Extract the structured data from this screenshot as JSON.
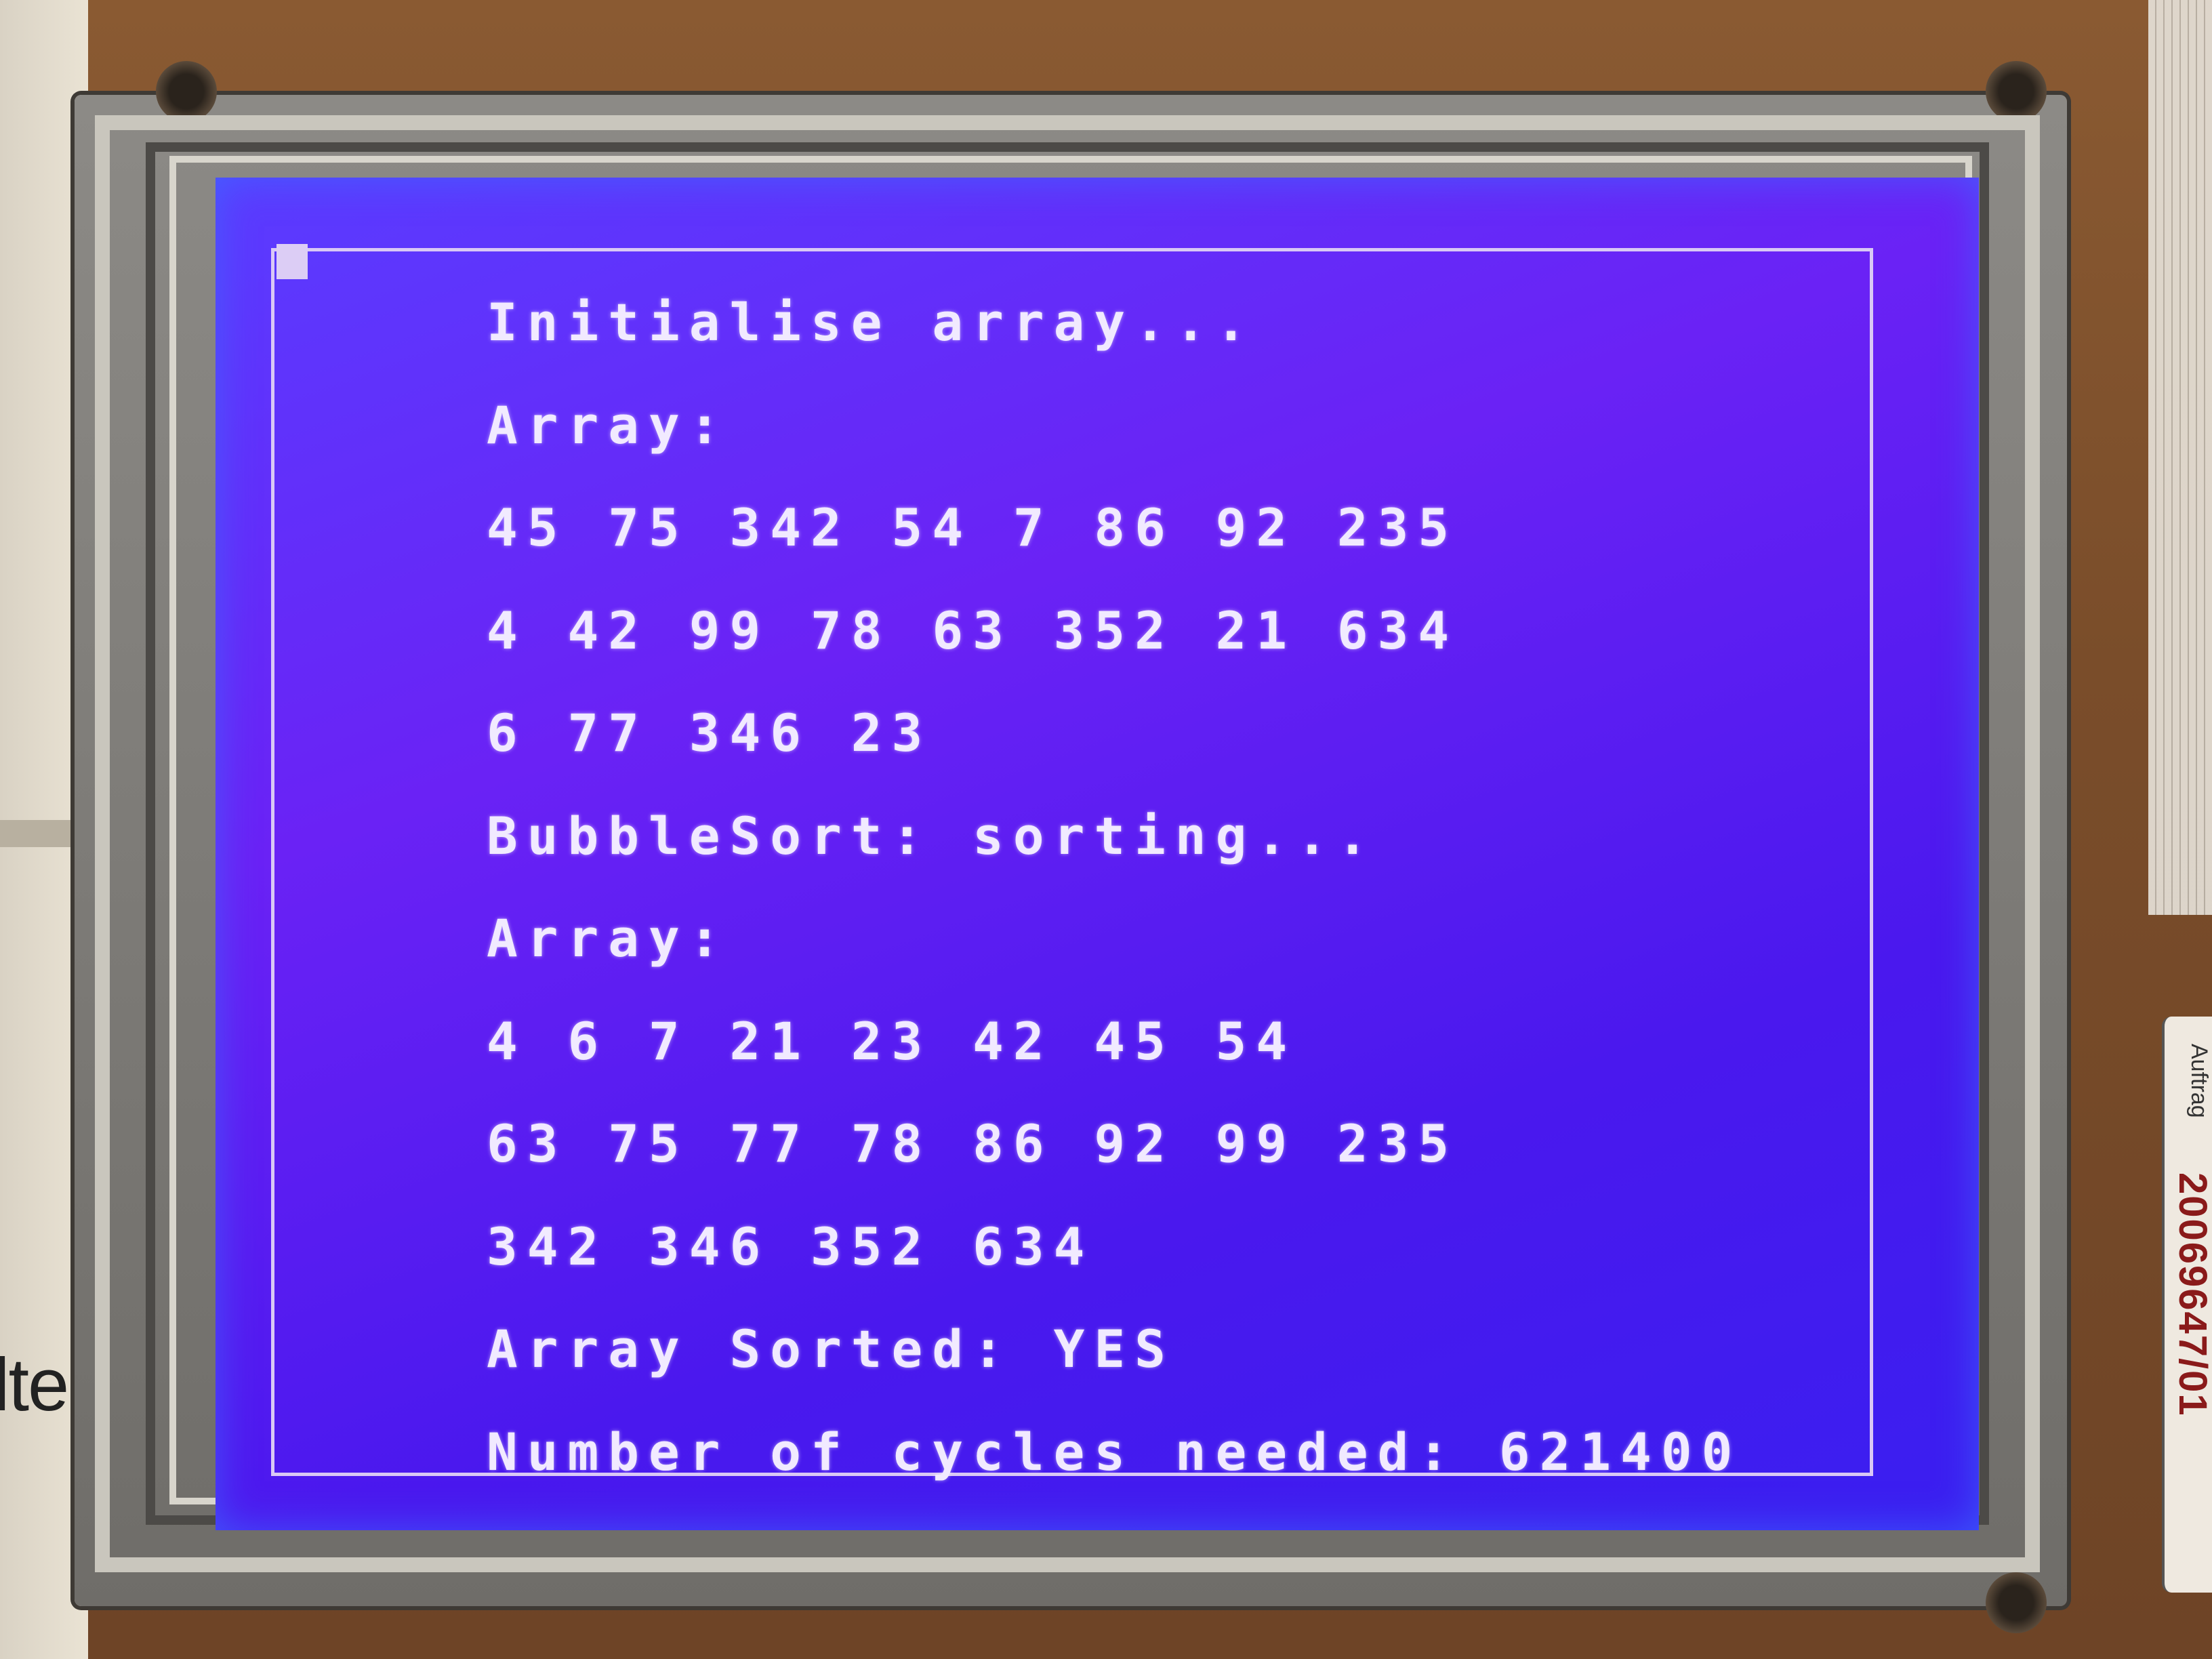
{
  "screen": {
    "lines": [
      "Initialise array...",
      "Array:",
      "45 75 342 54 7 86 92 235",
      "4 42 99 78 63 352 21 634",
      "6 77 346 23",
      "BubbleSort: sorting...",
      "Array:",
      "4 6 7 21 23 42 45 54",
      "63 75 77 78 86 92 99 235",
      "342 346 352 634",
      "Array Sorted: YES",
      "Number of cycles needed: 621400"
    ]
  },
  "sticker": {
    "label": "Auftrag",
    "number": "20069647/01"
  },
  "paper": {
    "fragment": "lte"
  },
  "colors": {
    "screen_background": "#5a2cf6",
    "screen_text": "#f1eaff",
    "board": "#7a4d2a"
  }
}
